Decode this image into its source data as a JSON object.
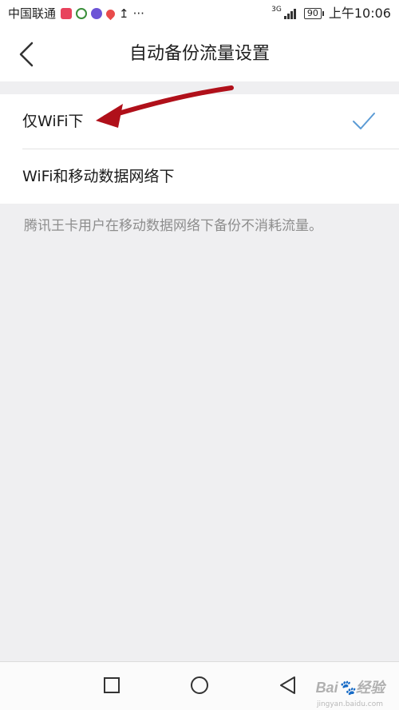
{
  "status_bar": {
    "carrier": "中国联通",
    "more": "···",
    "network": "3G",
    "battery": "90",
    "time": "上午10:06"
  },
  "header": {
    "title": "自动备份流量设置"
  },
  "options": [
    {
      "label": "仅WiFi下",
      "selected": true
    },
    {
      "label": "WiFi和移动数据网络下",
      "selected": false
    }
  ],
  "hint": "腾讯王卡用户在移动数据网络下备份不消耗流量。",
  "watermark": {
    "text": "Bai🐾经验",
    "sub": "jingyan.baidu.com"
  },
  "colors": {
    "check": "#5b9bd5",
    "annotation_arrow": "#b0101a"
  }
}
